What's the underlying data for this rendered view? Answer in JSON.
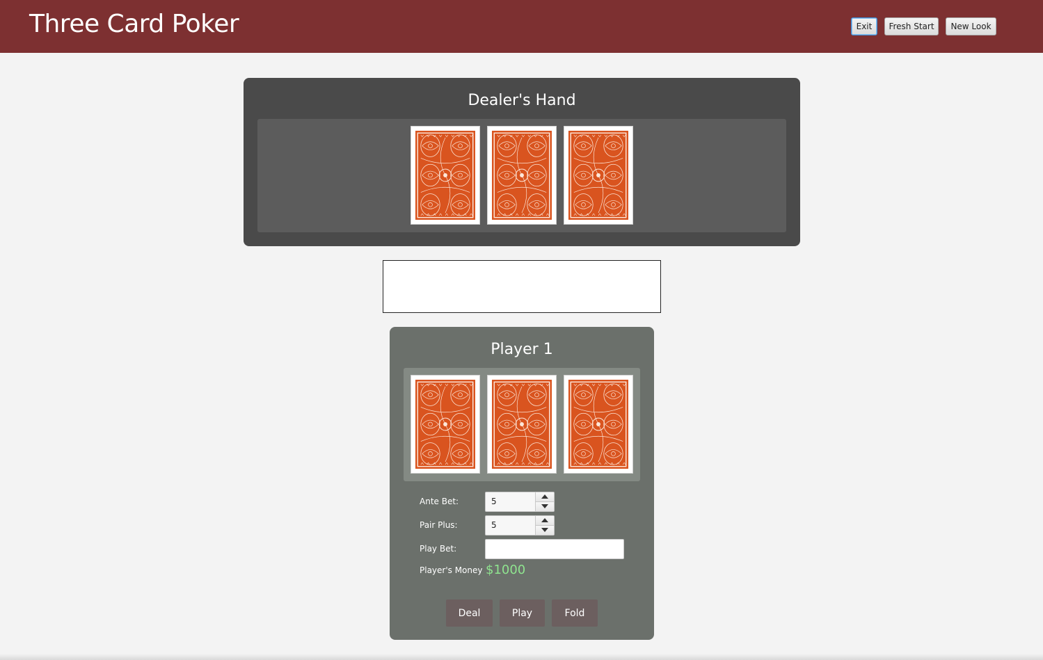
{
  "header": {
    "title": "Three Card Poker",
    "buttons": {
      "exit": "Exit",
      "fresh_start": "Fresh Start",
      "new_look": "New Look"
    }
  },
  "dealer": {
    "title": "Dealer's Hand",
    "cards": [
      "card-back",
      "card-back",
      "card-back"
    ]
  },
  "message": "",
  "player": {
    "title": "Player 1",
    "cards": [
      "card-back",
      "card-back",
      "card-back"
    ],
    "ante_bet": {
      "label": "Ante Bet:",
      "value": "5"
    },
    "pair_plus": {
      "label": "Pair Plus:",
      "value": "5"
    },
    "play_bet": {
      "label": "Play Bet:",
      "value": ""
    },
    "money": {
      "label": "Player's Money",
      "value": "$1000"
    },
    "actions": {
      "deal": "Deal",
      "play": "Play",
      "fold": "Fold"
    }
  },
  "colors": {
    "header": "#7d3031",
    "dealer_panel": "#4a4a4a",
    "player_panel": "#6b706b",
    "card_back": "#d9541f",
    "money": "#8fe48f",
    "action_button": "#6c5f5f"
  }
}
